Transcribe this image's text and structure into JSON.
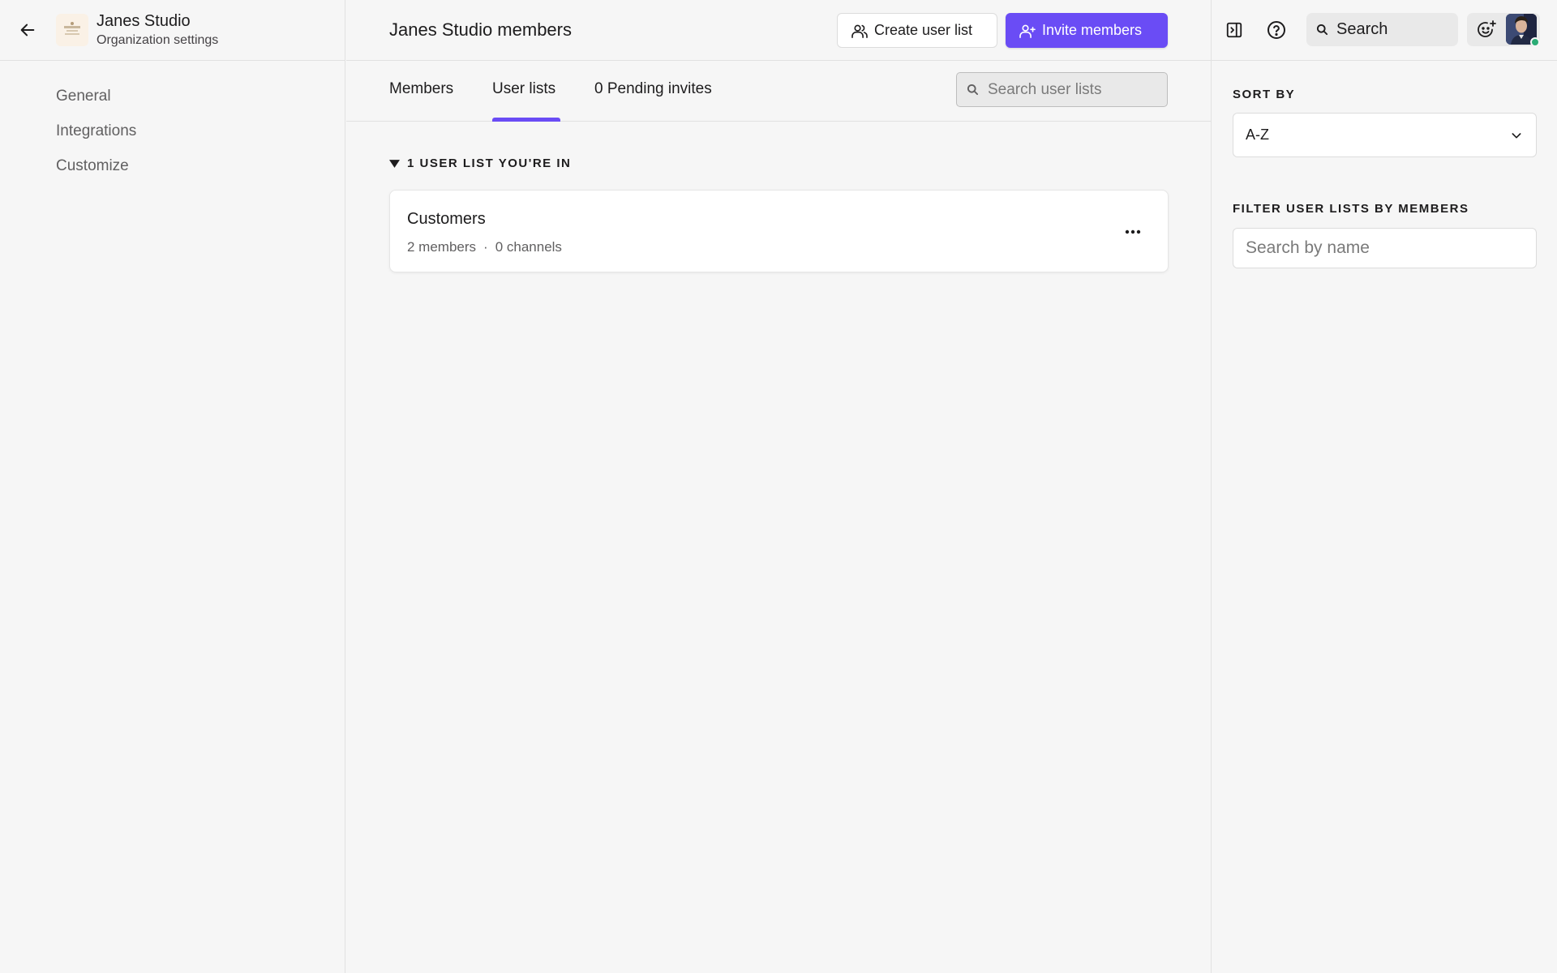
{
  "org": {
    "name": "Janes Studio",
    "subtitle": "Organization settings"
  },
  "nav": {
    "items": [
      {
        "label": "General"
      },
      {
        "label": "Integrations"
      },
      {
        "label": "Customize"
      }
    ]
  },
  "header": {
    "title": "Janes Studio members",
    "create_label": "Create user list",
    "invite_label": "Invite members"
  },
  "tabs": {
    "members": "Members",
    "user_lists": "User lists",
    "pending": "0 Pending invites",
    "active": "user_lists"
  },
  "search_lists": {
    "placeholder": "Search user lists"
  },
  "section": {
    "title": "1 USER LIST YOU'RE IN"
  },
  "lists": [
    {
      "name": "Customers",
      "members": "2 members",
      "channels": "0 channels"
    }
  ],
  "topbar": {
    "search_label": "Search"
  },
  "right": {
    "sort_label": "SORT BY",
    "sort_value": "A-Z",
    "filter_label": "FILTER USER LISTS BY MEMBERS",
    "filter_placeholder": "Search by name"
  },
  "colors": {
    "accent": "#6a4cf5",
    "presence": "#2bac76"
  }
}
